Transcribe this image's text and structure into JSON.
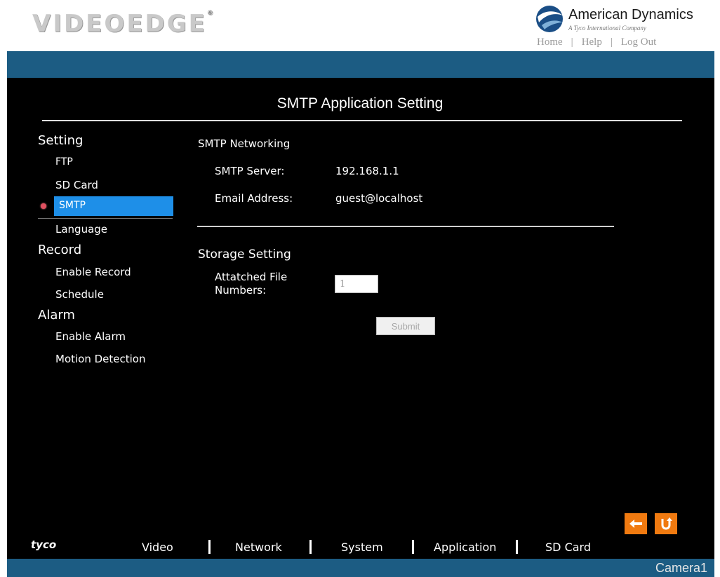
{
  "header": {
    "product_logo_main": "VIDEOEDGE",
    "product_logo_reg": "®",
    "brand_name": "American Dynamics",
    "brand_subtitle": "A Tyco International Company",
    "links": [
      "Home",
      "Help",
      "Log Out"
    ],
    "link_separator": "|"
  },
  "page": {
    "title": "SMTP Application Setting"
  },
  "sidebar": {
    "sections": [
      {
        "label": "Setting",
        "items": [
          "FTP",
          "SD Card",
          "SMTP",
          "Language"
        ]
      },
      {
        "label": "Record",
        "items": [
          "Enable Record",
          "Schedule"
        ]
      },
      {
        "label": "Alarm",
        "items": [
          "Enable Alarm",
          "Motion Detection"
        ]
      }
    ],
    "active_item": "SMTP"
  },
  "smtp_networking": {
    "heading": "SMTP Networking",
    "server_label": "SMTP Server:",
    "server_value": "192.168.1.1",
    "email_label": "Email Address:",
    "email_value": "guest@localhost"
  },
  "storage": {
    "heading": "Storage Setting",
    "file_numbers_label_line1": "Attatched File",
    "file_numbers_label_line2": "Numbers:",
    "file_numbers_value": "1"
  },
  "submit_label": "Submit",
  "footer": {
    "brand": "tyco",
    "nav": [
      "Video",
      "Network",
      "System",
      "Application",
      "SD Card"
    ],
    "camera": "Camera1"
  },
  "colors": {
    "top_bar": "#1c5c83",
    "panel": "#000000",
    "active_item": "#1e8fe8",
    "icon_buttons": "#f07a10"
  },
  "icons": {
    "back": "arrow-left-icon",
    "refresh": "refresh-icon",
    "brand": "american-dynamics-globe-icon",
    "active_marker": "red-dot-icon"
  }
}
